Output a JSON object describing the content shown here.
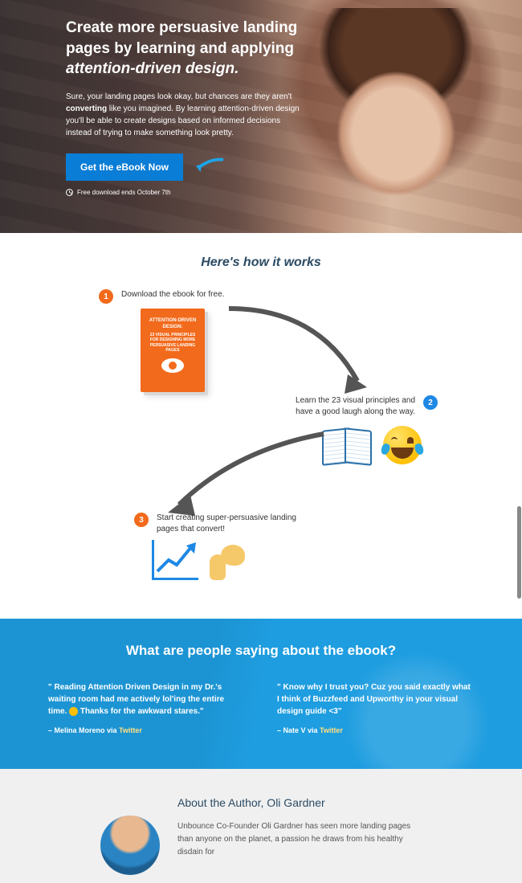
{
  "hero": {
    "title_pre": "Create more persuasive landing pages by learning and applying ",
    "title_em": "attention-driven design.",
    "subtitle_pre": "Sure, your landing pages look okay, but chances are they aren't ",
    "subtitle_strong": "converting",
    "subtitle_post": " like you imagined. By learning attention-driven design you'll be able to create designs based on informed decisions instead of trying to make something look pretty.",
    "cta_label": "Get the eBook Now",
    "note": "Free download ends October 7th"
  },
  "works": {
    "title": "Here's how it works",
    "steps": [
      {
        "num": "1",
        "text": "Download the ebook for free."
      },
      {
        "num": "2",
        "text": "Learn the 23 visual principles and have a good laugh along the way."
      },
      {
        "num": "3",
        "text": "Start creating super-persuasive landing pages that convert!"
      }
    ],
    "book_line1": "ATTENTION-DRIVEN",
    "book_line2": "DESIGN:",
    "book_line3": "23 VISUAL PRINCIPLES FOR DESIGNING MORE PERSUASIVE LANDING PAGES"
  },
  "social": {
    "title": "What are people saying about the ebook?",
    "quotes": [
      {
        "text_pre": "\" Reading Attention Driven Design in my Dr.'s waiting room had me actively lol'ing the entire time. ",
        "text_post": " Thanks for the awkward stares.\"",
        "author_pre": "– Melina Moreno via ",
        "author_link": "Twitter"
      },
      {
        "text": "\" Know why I trust you? Cuz you said exactly what I think of Buzzfeed and Upworthy in your visual design guide <3\"",
        "author_pre": "– Nate V via ",
        "author_link": "Twitter"
      }
    ]
  },
  "author": {
    "title": "About the Author, Oli Gardner",
    "text": "Unbounce Co-Founder Oli Gardner has seen more landing pages than anyone on the planet, a passion he draws from his healthy disdain for"
  }
}
